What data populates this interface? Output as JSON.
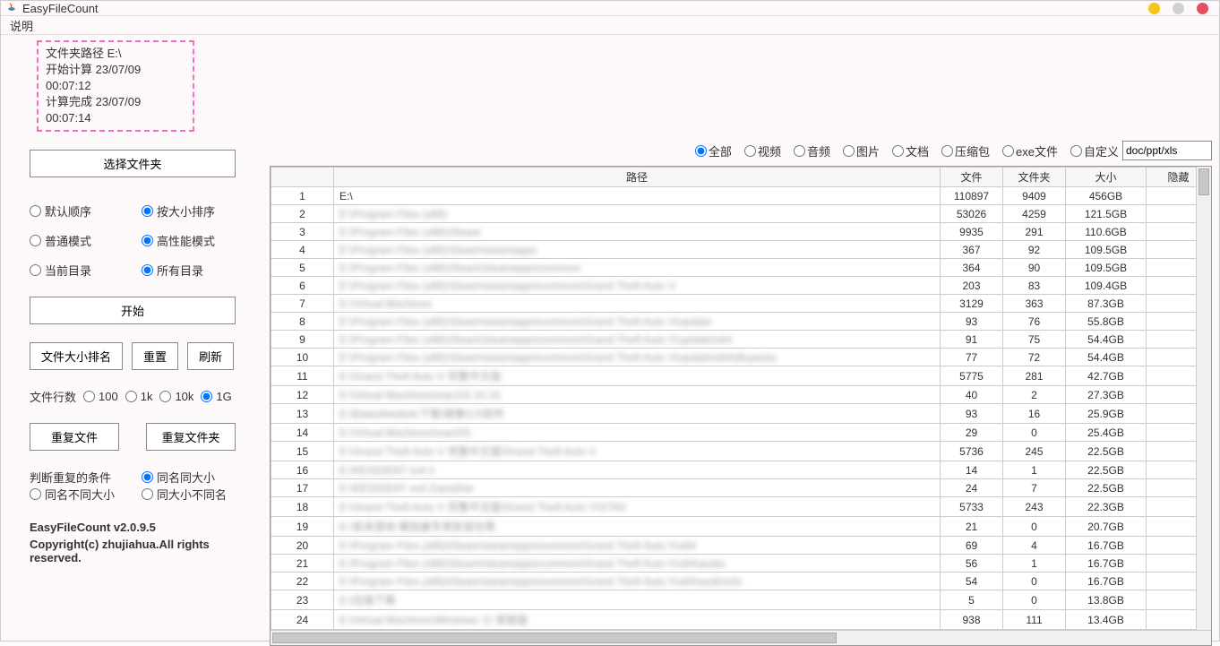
{
  "window": {
    "title": "EasyFileCount"
  },
  "menu": {
    "help_label": "说明"
  },
  "status": {
    "path_label": "文件夹路径 E:\\",
    "start_label": "开始计算 23/07/09 00:07:12",
    "done_label": "计算完成 23/07/09 00:07:14"
  },
  "sidebar": {
    "select_folder_label": "选择文件夹",
    "sort_default": "默认顺序",
    "sort_size": "按大小排序",
    "mode_normal": "普通模式",
    "mode_high": "高性能模式",
    "dir_current": "当前目录",
    "dir_all": "所有目录",
    "start_label": "开始",
    "rank_label": "文件大小排名",
    "reset_label": "重置",
    "refresh_label": "刷新",
    "rows_label": "文件行数",
    "row_100": "100",
    "row_1k": "1k",
    "row_10k": "10k",
    "row_1g": "1G",
    "dup_files_label": "重复文件",
    "dup_dirs_label": "重复文件夹",
    "cond_label": "判断重复的条件",
    "cond_name_size": "同名同大小",
    "cond_name_not_size": "同名不同大小",
    "cond_size_not_name": "同大小不同名",
    "version": "EasyFileCount v2.0.9.5",
    "copyright": "Copyright(c) zhujiahua.All rights reserved."
  },
  "filters": {
    "all": "全部",
    "video": "视频",
    "audio": "音频",
    "image": "图片",
    "doc": "文档",
    "archive": "压缩包",
    "exe": "exe文件",
    "custom": "自定义",
    "custom_value": "doc/ppt/xls"
  },
  "table": {
    "headers": {
      "path": "路径",
      "files": "文件",
      "dirs": "文件夹",
      "size": "大小",
      "hidden": "隐藏"
    },
    "rows": [
      {
        "idx": "1",
        "path": "E:\\",
        "blur": false,
        "files": "110897",
        "dirs": "9409",
        "size": "456GB"
      },
      {
        "idx": "2",
        "path": "E:\\Program Files (x86)",
        "blur": true,
        "files": "53026",
        "dirs": "4259",
        "size": "121.5GB"
      },
      {
        "idx": "3",
        "path": "E:\\Program Files (x86)\\Steam",
        "blur": true,
        "files": "9935",
        "dirs": "291",
        "size": "110.6GB"
      },
      {
        "idx": "4",
        "path": "E:\\Program Files (x86)\\Steam\\steamapps",
        "blur": true,
        "files": "367",
        "dirs": "92",
        "size": "109.5GB"
      },
      {
        "idx": "5",
        "path": "E:\\Program Files (x86)\\Steam\\steamapps\\common",
        "blur": true,
        "files": "364",
        "dirs": "90",
        "size": "109.5GB"
      },
      {
        "idx": "6",
        "path": "E:\\Program Files (x86)\\Steam\\steamapps\\common\\Grand Theft Auto V",
        "blur": true,
        "files": "203",
        "dirs": "83",
        "size": "109.4GB"
      },
      {
        "idx": "7",
        "path": "E:\\Virtual Machines",
        "blur": true,
        "files": "3129",
        "dirs": "363",
        "size": "87.3GB"
      },
      {
        "idx": "8",
        "path": "E:\\Program Files (x86)\\Steam\\steamapps\\common\\Grand Theft Auto V\\update",
        "blur": true,
        "files": "93",
        "dirs": "76",
        "size": "55.8GB"
      },
      {
        "idx": "9",
        "path": "E:\\Program Files (x86)\\Steam\\steamapps\\common\\Grand Theft Auto V\\update\\x64",
        "blur": true,
        "files": "91",
        "dirs": "75",
        "size": "54.4GB"
      },
      {
        "idx": "10",
        "path": "E:\\Program Files (x86)\\Steam\\steamapps\\common\\Grand Theft Auto V\\update\\x64\\dlcpacks",
        "blur": true,
        "files": "77",
        "dirs": "72",
        "size": "54.4GB"
      },
      {
        "idx": "11",
        "path": "E:\\Grand Theft Auto V 完整中文版",
        "blur": true,
        "files": "5775",
        "dirs": "281",
        "size": "42.7GB"
      },
      {
        "idx": "12",
        "path": "E:\\Virtual Machines\\macOS 10.15",
        "blur": true,
        "files": "40",
        "dirs": "2",
        "size": "27.3GB"
      },
      {
        "idx": "13",
        "path": "E:\\BaiduNetdisk\\下载\\镜像\\CS软件",
        "blur": true,
        "files": "93",
        "dirs": "16",
        "size": "25.9GB"
      },
      {
        "idx": "14",
        "path": "E:\\Virtual Machines\\macOS",
        "blur": true,
        "files": "29",
        "dirs": "0",
        "size": "25.4GB"
      },
      {
        "idx": "15",
        "path": "E:\\Grand Theft Auto V 完整中文版\\Grand Theft Auto V",
        "blur": true,
        "files": "5736",
        "dirs": "245",
        "size": "22.5GB"
      },
      {
        "idx": "16",
        "path": "E:\\RESIDENT evil 2",
        "blur": true,
        "files": "14",
        "dirs": "1",
        "size": "22.5GB"
      },
      {
        "idx": "17",
        "path": "E:\\RESIDENT evil 2\\another",
        "blur": true,
        "files": "24",
        "dirs": "7",
        "size": "22.5GB"
      },
      {
        "idx": "18",
        "path": "E:\\Grand Theft Auto V 完整中文版\\Grand Theft Auto V\\GTAV",
        "blur": true,
        "files": "5733",
        "dirs": "243",
        "size": "22.3GB"
      },
      {
        "idx": "19",
        "path": "E:\\安卓游戏 模拟器专用安装包等",
        "blur": true,
        "files": "21",
        "dirs": "0",
        "size": "20.7GB"
      },
      {
        "idx": "20",
        "path": "E:\\Program Files (x86)\\Steam\\steamapps\\common\\Grand Theft Auto V\\x64",
        "blur": true,
        "files": "69",
        "dirs": "4",
        "size": "16.7GB"
      },
      {
        "idx": "21",
        "path": "E:\\Program Files (x86)\\Steam\\steamapps\\common\\Grand Theft Auto V\\x64\\audio",
        "blur": true,
        "files": "56",
        "dirs": "1",
        "size": "16.7GB"
      },
      {
        "idx": "22",
        "path": "E:\\Program Files (x86)\\Steam\\steamapps\\common\\Grand Theft Auto V\\x64\\audio\\sfx",
        "blur": true,
        "files": "54",
        "dirs": "0",
        "size": "16.7GB"
      },
      {
        "idx": "23",
        "path": "E:\\压缩下载",
        "blur": true,
        "files": "5",
        "dirs": "0",
        "size": "13.8GB"
      },
      {
        "idx": "24",
        "path": "E:\\Virtual Machines\\Windows 11 家庭版",
        "blur": true,
        "files": "938",
        "dirs": "111",
        "size": "13.4GB"
      }
    ]
  },
  "colors": {
    "min_btn": "#f5c518",
    "max_btn": "#d0d0d0",
    "close_btn": "#e05060"
  }
}
